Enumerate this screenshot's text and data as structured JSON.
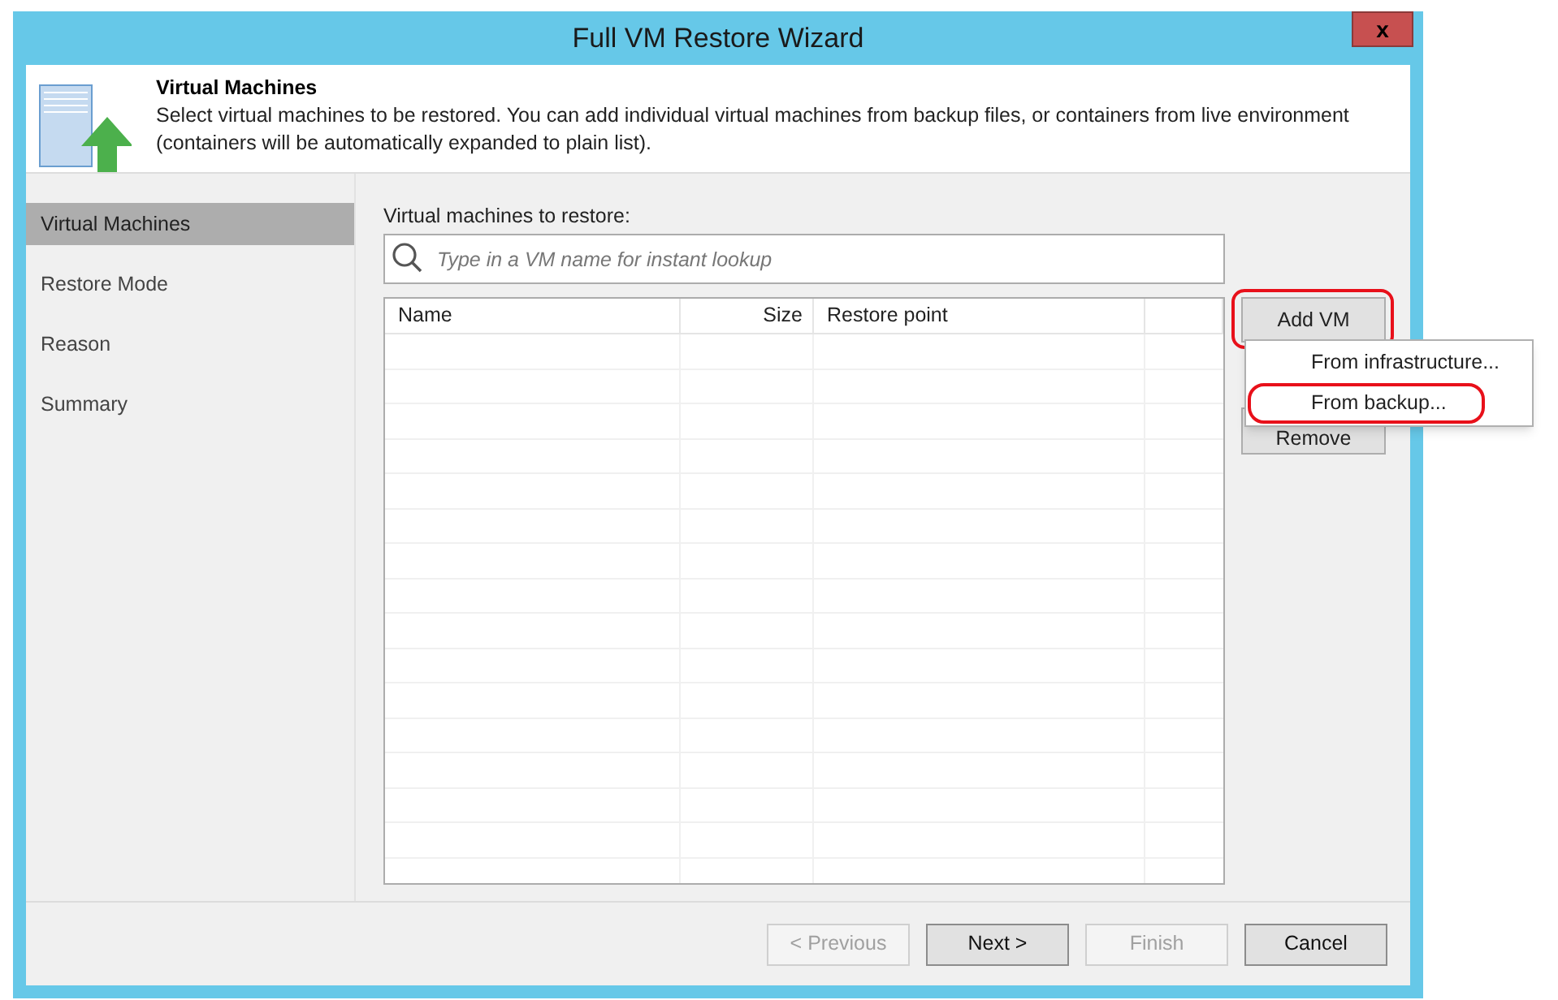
{
  "window": {
    "title": "Full VM Restore Wizard",
    "close": "x"
  },
  "header": {
    "title": "Virtual Machines",
    "description": "Select virtual machines to be restored. You  can add individual virtual machines from backup files, or containers from live environment (containers will be automatically expanded to plain list)."
  },
  "steps": [
    {
      "label": "Virtual Machines",
      "selected": true
    },
    {
      "label": "Restore Mode",
      "selected": false
    },
    {
      "label": "Reason",
      "selected": false
    },
    {
      "label": "Summary",
      "selected": false
    }
  ],
  "list_label": "Virtual machines to restore:",
  "search": {
    "placeholder": "Type in a VM name for instant lookup"
  },
  "table": {
    "columns": [
      {
        "label": "Name"
      },
      {
        "label": "Size"
      },
      {
        "label": "Restore point"
      }
    ]
  },
  "side_buttons": [
    {
      "label": "Add VM",
      "highlighted": true
    },
    {
      "label": "Remove",
      "highlighted": false
    }
  ],
  "menu": [
    {
      "label": "From infrastructure...",
      "highlighted": false
    },
    {
      "label": "From backup...",
      "highlighted": true
    }
  ],
  "buttons": [
    {
      "label": "< Previous",
      "disabled": true
    },
    {
      "label": "Next >",
      "disabled": false
    },
    {
      "label": "Finish",
      "disabled": true
    },
    {
      "label": "Cancel",
      "disabled": false
    }
  ]
}
